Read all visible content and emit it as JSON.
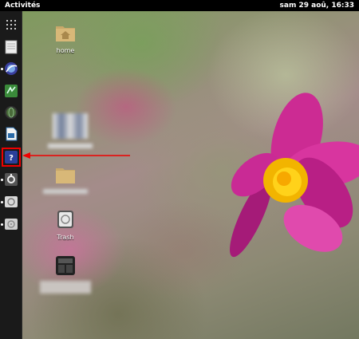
{
  "topbar": {
    "activities": "Activités",
    "datetime": "sam 29 aoû, 16:33"
  },
  "desktop_icons": {
    "home_label": "home",
    "trash_label": "Trash"
  },
  "colors": {
    "dash_bg": "#1a1a1a",
    "highlight": "#e00000",
    "arrow": "#e00000"
  },
  "dash": {
    "items": [
      "apps-grid-icon",
      "text-editor-icon",
      "web-browser-icon",
      "file-manager-icon",
      "globe-icon",
      "libreoffice-writer-icon",
      "help-icon",
      "system-settings-icon",
      "software-update-icon",
      "disk-icon"
    ],
    "selected": "help-icon"
  }
}
